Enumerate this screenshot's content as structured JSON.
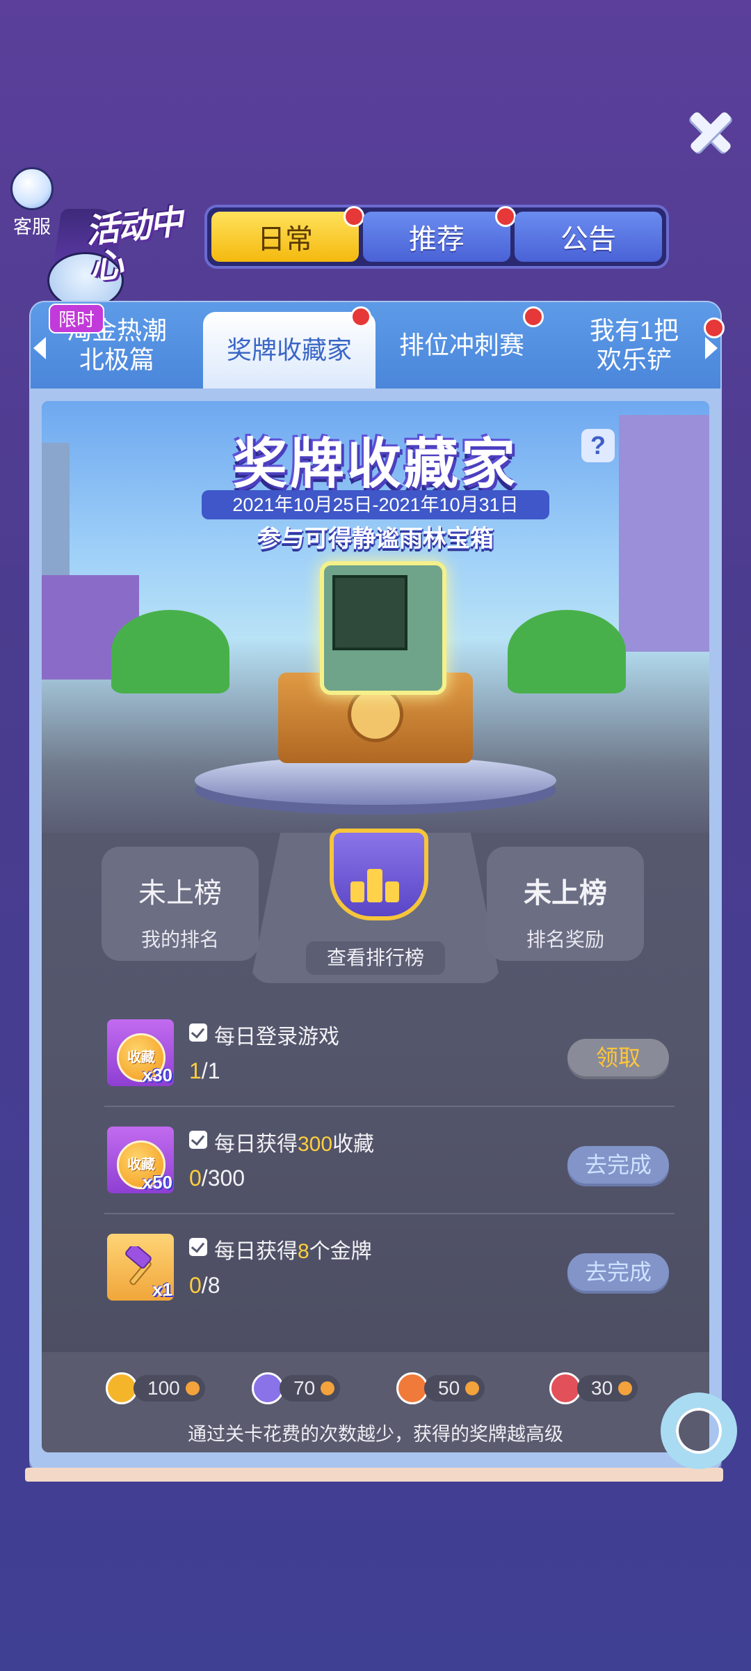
{
  "customer_service": {
    "label": "客服"
  },
  "activity_center": {
    "title": "活动中心"
  },
  "top_tabs": [
    {
      "label": "日常",
      "active": true,
      "badge": true
    },
    {
      "label": "推荐",
      "active": false,
      "badge": true
    },
    {
      "label": "公告",
      "active": false,
      "badge": false
    }
  ],
  "sub_tabs": {
    "limited_tag": "限时",
    "items": [
      {
        "label": "淘金热潮\n北极篇",
        "active": false,
        "badge": false
      },
      {
        "label": "奖牌收藏家",
        "active": true,
        "badge": true
      },
      {
        "label": "排位冲刺赛",
        "active": false,
        "badge": true
      },
      {
        "label": "我有1把\n欢乐铲",
        "active": false,
        "badge": true
      }
    ]
  },
  "banner": {
    "title": "奖牌收藏家",
    "help": "?",
    "dates": "2021年10月25日-2021年10月31日",
    "subtitle": "参与可得静谧雨林宝箱"
  },
  "rank": {
    "my_rank_value": "未上榜",
    "my_rank_label": "我的排名",
    "leaderboard_label": "查看排行榜",
    "reward_value": "未上榜",
    "reward_label": "排名奖励"
  },
  "tasks": [
    {
      "icon": "收藏",
      "qty": "x30",
      "desc_pre": "每日登录游戏",
      "desc_hl": "",
      "desc_post": "",
      "current": "1",
      "total": "/1",
      "button": "领取",
      "state": "claim"
    },
    {
      "icon": "收藏",
      "qty": "x50",
      "desc_pre": "每日获得",
      "desc_hl": "300",
      "desc_post": "收藏",
      "current": "0",
      "total": "/300",
      "button": "去完成",
      "state": "go"
    },
    {
      "icon": "hammer",
      "qty": "x1",
      "desc_pre": "每日获得",
      "desc_hl": "8",
      "desc_post": "个金牌",
      "current": "0",
      "total": "/8",
      "button": "去完成",
      "state": "go"
    }
  ],
  "medals": [
    {
      "name": "gold-medal",
      "value": "100",
      "color": "#f5b52a"
    },
    {
      "name": "purple-medal",
      "value": "70",
      "color": "#8a72e8"
    },
    {
      "name": "bronze-medal",
      "value": "50",
      "color": "#f07a3a"
    },
    {
      "name": "red-medal",
      "value": "30",
      "color": "#e2505a"
    }
  ],
  "footer_note": "通过关卡花费的次数越少，获得的奖牌越高级"
}
